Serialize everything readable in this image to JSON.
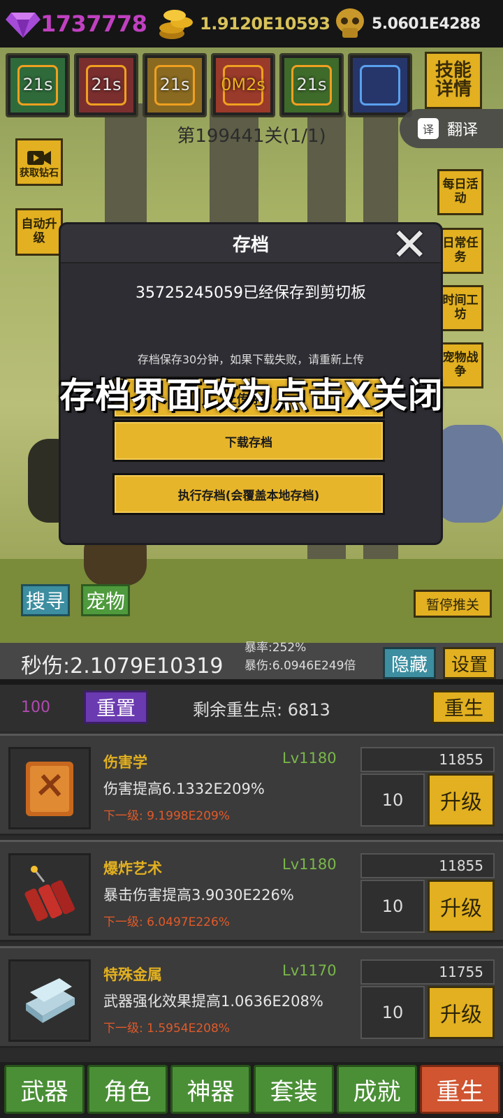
{
  "currency": {
    "gems": "1737778",
    "gold": "1.9120E10593",
    "souls": "5.0601E4288"
  },
  "skills": [
    {
      "cooldown": "21s",
      "color": "#2f6b3a"
    },
    {
      "cooldown": "21s",
      "color": "#7a2e2e"
    },
    {
      "cooldown": "21s",
      "color": "#8a6a20"
    },
    {
      "cooldown": "0M2s",
      "color": "#9a3a2a"
    },
    {
      "cooldown": "21s",
      "color": "#3e6a2a"
    },
    {
      "cooldown": "",
      "color": "#26366a"
    }
  ],
  "skill_detail_label": "技能详情",
  "stage": "第199441关(1/1)",
  "translate_label": "翻译",
  "translate_icon_text": "译",
  "left_buttons": {
    "get_diamonds": "获取钻石",
    "auto_upgrade": "自动升级"
  },
  "right_buttons": [
    "每日活动",
    "日常任务",
    "时间工坊",
    "宠物战争"
  ],
  "modal": {
    "title": "存档",
    "message": "35725245059已经保存到剪切板",
    "note": "存档保存30分钟，如果下载失败，请重新上传",
    "button_upload": "上传存档",
    "button_download": "下载存档",
    "button_execute": "执行存档(会覆盖本地存档)"
  },
  "overlay_caption": "存档界面改为点击X关闭",
  "scene_buttons": {
    "search": "搜寻",
    "pet": "宠物",
    "pause": "暂停推关"
  },
  "stats": {
    "dps": "秒伤:2.1079E10319",
    "crit_rate": "暴率:252%",
    "crit_dmg": "暴伤:6.0946E249倍",
    "hide": "隐藏",
    "settings": "设置"
  },
  "rebirth": {
    "points": "100",
    "reset": "重置",
    "remaining": "剩余重生点: 6813",
    "rebirth": "重生"
  },
  "upgrades": [
    {
      "name": "伤害学",
      "level": "Lv1180",
      "desc": "伤害提高6.1332E209%",
      "next": "下一级: 9.1998E209%",
      "cost": "11855",
      "qty": "10",
      "button": "升级"
    },
    {
      "name": "爆炸艺术",
      "level": "Lv1180",
      "desc": "暴击伤害提高3.9030E226%",
      "next": "下一级: 6.0497E226%",
      "cost": "11855",
      "qty": "10",
      "button": "升级"
    },
    {
      "name": "特殊金属",
      "level": "Lv1170",
      "desc": "武器强化效果提高1.0636E208%",
      "next": "下一级: 1.5954E208%",
      "cost": "11755",
      "qty": "10",
      "button": "升级"
    }
  ],
  "tabs": [
    "武器",
    "角色",
    "神器",
    "套装",
    "成就",
    "重生"
  ]
}
